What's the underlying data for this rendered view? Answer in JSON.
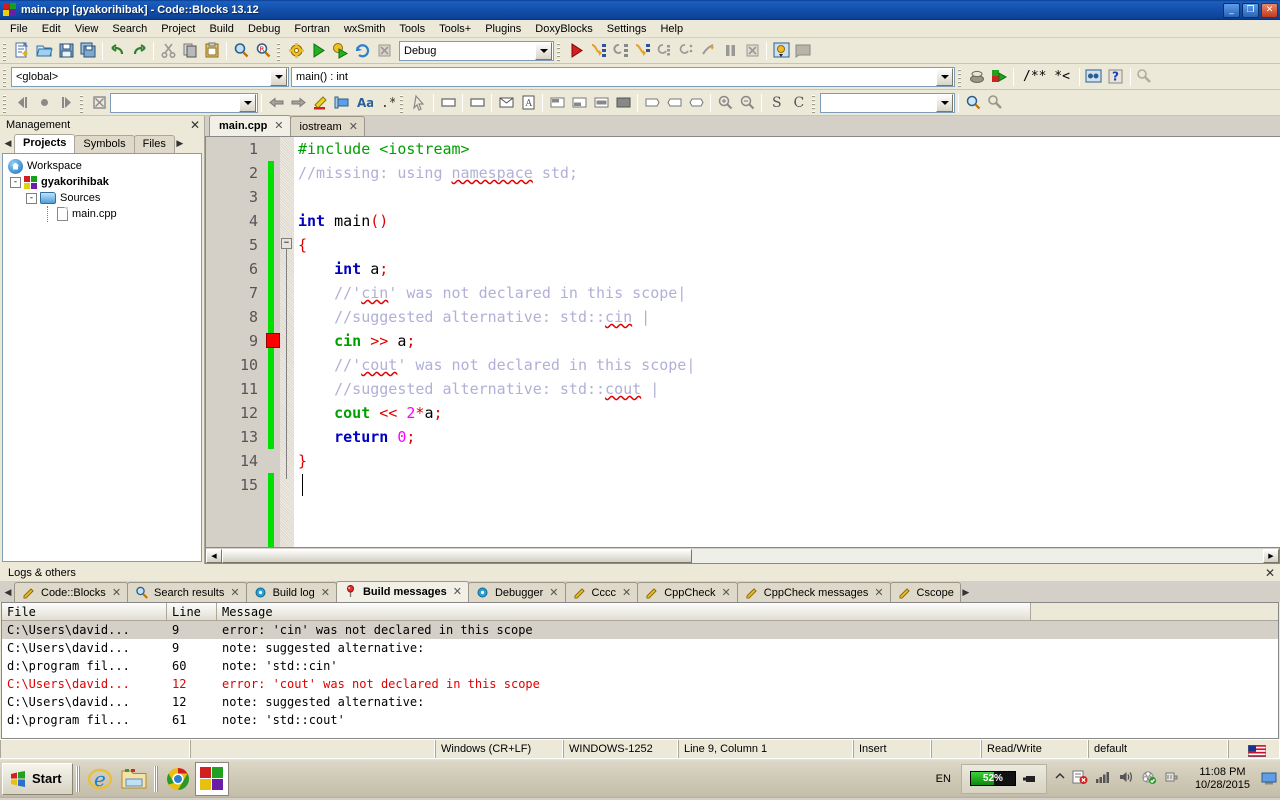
{
  "window": {
    "title": "main.cpp [gyakorihibak] - Code::Blocks 13.12",
    "minimize": "🗕",
    "maximize": "🗗",
    "close": "✕"
  },
  "menubar": {
    "items": [
      "File",
      "Edit",
      "View",
      "Search",
      "Project",
      "Build",
      "Debug",
      "Fortran",
      "wxSmith",
      "Tools",
      "Tools+",
      "Plugins",
      "DoxyBlocks",
      "Settings",
      "Help"
    ]
  },
  "toolbars": {
    "build_target": {
      "value": "Debug"
    },
    "scope": {
      "value": "<global>"
    },
    "function": {
      "value": "main() : int"
    },
    "search_box": {
      "value": ""
    },
    "goto_box": {
      "value": ""
    },
    "doxy_label": "/** *<",
    "row1_icons": [
      "new-file-icon",
      "open-file-icon",
      "save-icon",
      "save-all-icon",
      "undo-icon",
      "redo-icon",
      "cut-icon",
      "copy-icon",
      "paste-icon",
      "find-icon",
      "replace-icon",
      "build-icon",
      "run-icon",
      "build-and-run-icon",
      "rebuild-icon",
      "abort-icon"
    ],
    "row1b_icons": [
      "debug-continue-icon",
      "step-over-icon",
      "step-into-icon",
      "step-out-icon",
      "next-instruction-icon",
      "step-into-instruction-icon",
      "break-debugger-icon",
      "pause-icon",
      "stop-debugger-icon",
      "debugging-windows-icon",
      "various-info-icon"
    ],
    "row2_icons": [
      "doxyblocks-run-icon",
      "doxyblocks-extract-icon",
      "doxyblocks-comment-icon",
      "doxyblocks-wizard-icon",
      "doxyblocks-help-icon",
      "doxyblocks-config-icon"
    ],
    "row3_icons": [
      "back-icon",
      "dot-icon",
      "forward-icon",
      "clear-icon",
      "prev-icon",
      "next-icon",
      "highlight-icon",
      "selection-icon",
      "match-case-icon",
      "regex-icon",
      "pointer-icon",
      "box-icon",
      "box2-icon",
      "mail-icon",
      "abc-icon",
      "block-top-icon",
      "block-bottom-icon",
      "block-mid-icon",
      "block-full-icon",
      "wide-icon",
      "narrow-icon",
      "stretch-icon",
      "zoom-in-icon",
      "zoom-out-icon",
      "s-icon",
      "c-icon",
      "last-search-icon",
      "search-files-icon",
      "settings-icon"
    ]
  },
  "management": {
    "title": "Management",
    "close": "✕",
    "tabs": [
      {
        "label": "Projects",
        "active": true
      },
      {
        "label": "Symbols",
        "active": false
      },
      {
        "label": "Files",
        "active": false
      }
    ],
    "tree": [
      {
        "label": "Workspace",
        "icon": "workspace-icon",
        "indent": 0,
        "toggle": "",
        "bold": false
      },
      {
        "label": "gyakorihibak",
        "icon": "project-icon",
        "indent": 1,
        "toggle": "-",
        "bold": true
      },
      {
        "label": "Sources",
        "icon": "folder-icon",
        "indent": 2,
        "toggle": "-",
        "bold": false
      },
      {
        "label": "main.cpp",
        "icon": "file-icon",
        "indent": 3,
        "toggle": "",
        "bold": false
      }
    ]
  },
  "editor": {
    "tabs": [
      {
        "label": "main.cpp",
        "active": true,
        "close": "✕"
      },
      {
        "label": "iostream",
        "active": false,
        "close": "✕"
      }
    ],
    "line_numbers": [
      "1",
      "2",
      "3",
      "4",
      "5",
      "6",
      "7",
      "8",
      "9",
      "10",
      "11",
      "12",
      "13",
      "14",
      "15"
    ],
    "breakpoint_line": 9,
    "lines": [
      {
        "n": 1,
        "tokens": [
          {
            "t": "#include <iostream>",
            "c": "pp"
          }
        ]
      },
      {
        "n": 2,
        "tokens": [
          {
            "t": "//missing: using ",
            "c": "cm"
          },
          {
            "t": "namespace",
            "c": "cm sq"
          },
          {
            "t": " std;",
            "c": "cm"
          }
        ]
      },
      {
        "n": 3,
        "tokens": []
      },
      {
        "n": 4,
        "tokens": [
          {
            "t": "int",
            "c": "k"
          },
          {
            "t": " main",
            "c": "id"
          },
          {
            "t": "()",
            "c": "op"
          }
        ]
      },
      {
        "n": 5,
        "tokens": [
          {
            "t": "{",
            "c": "op"
          }
        ]
      },
      {
        "n": 6,
        "tokens": [
          {
            "t": "    ",
            "c": "id"
          },
          {
            "t": "int",
            "c": "k"
          },
          {
            "t": " a",
            "c": "id"
          },
          {
            "t": ";",
            "c": "op"
          }
        ]
      },
      {
        "n": 7,
        "tokens": [
          {
            "t": "    //'",
            "c": "cm"
          },
          {
            "t": "cin",
            "c": "cm sq"
          },
          {
            "t": "' was not declared in this scope|",
            "c": "cm"
          }
        ]
      },
      {
        "n": 8,
        "tokens": [
          {
            "t": "    //suggested alternative: std::",
            "c": "cm"
          },
          {
            "t": "cin",
            "c": "cm sq"
          },
          {
            "t": " |",
            "c": "cm"
          }
        ]
      },
      {
        "n": 9,
        "tokens": [
          {
            "t": "    ",
            "c": "id"
          },
          {
            "t": "cin",
            "c": "gfn"
          },
          {
            "t": " >> ",
            "c": "op"
          },
          {
            "t": "a",
            "c": "id"
          },
          {
            "t": ";",
            "c": "op"
          }
        ]
      },
      {
        "n": 10,
        "tokens": [
          {
            "t": "    //'",
            "c": "cm"
          },
          {
            "t": "cout",
            "c": "cm sq"
          },
          {
            "t": "' was not declared in this scope|",
            "c": "cm"
          }
        ]
      },
      {
        "n": 11,
        "tokens": [
          {
            "t": "    //suggested alternative: std::",
            "c": "cm"
          },
          {
            "t": "cout",
            "c": "cm sq"
          },
          {
            "t": " |",
            "c": "cm"
          }
        ]
      },
      {
        "n": 12,
        "tokens": [
          {
            "t": "    ",
            "c": "id"
          },
          {
            "t": "cout",
            "c": "gfn"
          },
          {
            "t": " << ",
            "c": "op"
          },
          {
            "t": "2",
            "c": "num"
          },
          {
            "t": "*",
            "c": "op"
          },
          {
            "t": "a",
            "c": "id"
          },
          {
            "t": ";",
            "c": "op"
          }
        ]
      },
      {
        "n": 13,
        "tokens": [
          {
            "t": "    ",
            "c": "id"
          },
          {
            "t": "return",
            "c": "k"
          },
          {
            "t": " ",
            "c": "id"
          },
          {
            "t": "0",
            "c": "num"
          },
          {
            "t": ";",
            "c": "op"
          }
        ]
      },
      {
        "n": 14,
        "tokens": [
          {
            "t": "}",
            "c": "op"
          }
        ]
      },
      {
        "n": 15,
        "tokens": []
      }
    ]
  },
  "logs": {
    "title": "Logs & others",
    "close": "✕",
    "tabs": [
      {
        "label": "Code::Blocks",
        "icon": "pencil-icon",
        "active": false,
        "close": "✕"
      },
      {
        "label": "Search results",
        "icon": "magnifier-icon",
        "active": false,
        "close": "✕"
      },
      {
        "label": "Build log",
        "icon": "gear-blue-icon",
        "active": false,
        "close": "✕"
      },
      {
        "label": "Build messages",
        "icon": "pin-icon",
        "active": true,
        "close": "✕"
      },
      {
        "label": "Debugger",
        "icon": "gear-blue-icon",
        "active": false,
        "close": "✕"
      },
      {
        "label": "Cccc",
        "icon": "pencil-icon",
        "active": false,
        "close": "✕"
      },
      {
        "label": "CppCheck",
        "icon": "pencil-icon",
        "active": false,
        "close": "✕"
      },
      {
        "label": "CppCheck messages",
        "icon": "pencil-icon",
        "active": false,
        "close": "✕"
      },
      {
        "label": "Cscope",
        "icon": "pencil-icon",
        "active": false,
        "close": ""
      }
    ],
    "columns": [
      "File",
      "Line",
      "Message"
    ],
    "rows": [
      {
        "file": "C:\\Users\\david...",
        "line": "9",
        "message": "error: 'cin' was not declared in this scope",
        "error": false,
        "selected": true
      },
      {
        "file": "C:\\Users\\david...",
        "line": "9",
        "message": "note: suggested alternative:",
        "error": false,
        "selected": false
      },
      {
        "file": "d:\\program fil...",
        "line": "60",
        "message": "note:   'std::cin'",
        "error": false,
        "selected": false
      },
      {
        "file": "C:\\Users\\david...",
        "line": "12",
        "message": "error: 'cout' was not declared in this scope",
        "error": true,
        "selected": false
      },
      {
        "file": "C:\\Users\\david...",
        "line": "12",
        "message": "note: suggested alternative:",
        "error": false,
        "selected": false
      },
      {
        "file": "d:\\program fil...",
        "line": "61",
        "message": "note:   'std::cout'",
        "error": false,
        "selected": false
      }
    ]
  },
  "statusbar": {
    "cells": [
      "",
      "",
      "Windows (CR+LF)",
      "WINDOWS-1252",
      "Line 9, Column 1",
      "Insert",
      "",
      "Read/Write",
      "default"
    ],
    "flag_icon": "us-flag-icon"
  },
  "taskbar": {
    "start": "Start",
    "quicklaunch": [
      "internet-explorer-icon",
      "file-explorer-icon",
      "google-chrome-icon"
    ],
    "tasks": [
      {
        "icon": "codeblocks-icon",
        "active": true
      }
    ],
    "language": "EN",
    "battery_percent": "52%",
    "battery_level": 52,
    "tray_icons": [
      "show-hidden-icon",
      "action-center-icon",
      "network-icon",
      "volume-icon",
      "security-icon",
      "power-plug-icon"
    ],
    "time": "11:08 PM",
    "date": "10/28/2015",
    "show_desktop": "show-desktop-icon"
  }
}
